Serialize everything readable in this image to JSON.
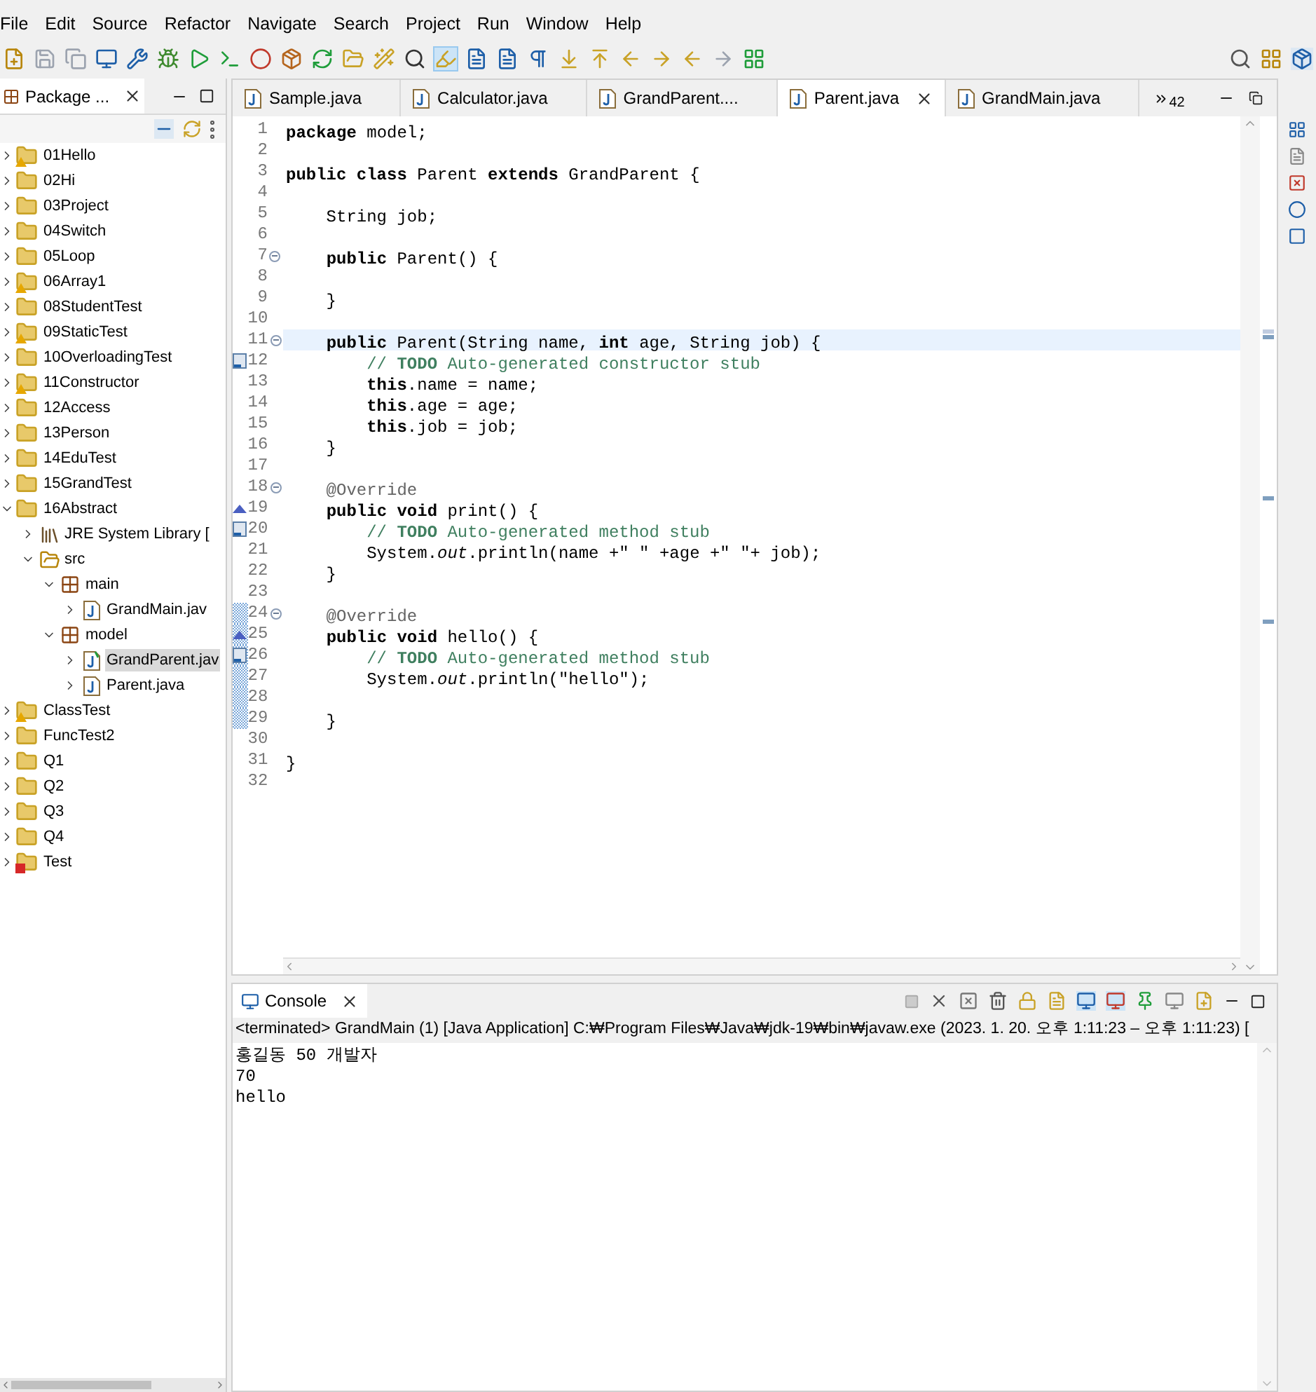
{
  "menu": [
    "File",
    "Edit",
    "Source",
    "Refactor",
    "Navigate",
    "Search",
    "Project",
    "Run",
    "Window",
    "Help"
  ],
  "package_explorer": {
    "title": "Package ...",
    "tree": [
      {
        "label": "01Hello",
        "kind": "project",
        "warning": true,
        "error": false,
        "expanded": false,
        "selected": false
      },
      {
        "label": "02Hi",
        "kind": "project",
        "warning": false,
        "error": false,
        "expanded": false,
        "selected": false
      },
      {
        "label": "03Project",
        "kind": "project",
        "warning": false,
        "error": false,
        "expanded": false,
        "selected": false
      },
      {
        "label": "04Switch",
        "kind": "project",
        "warning": false,
        "error": false,
        "expanded": false,
        "selected": false
      },
      {
        "label": "05Loop",
        "kind": "project",
        "warning": false,
        "error": false,
        "expanded": false,
        "selected": false
      },
      {
        "label": "06Array1",
        "kind": "project",
        "warning": true,
        "error": false,
        "expanded": false,
        "selected": false
      },
      {
        "label": "08StudentTest",
        "kind": "project",
        "warning": false,
        "error": false,
        "expanded": false,
        "selected": false
      },
      {
        "label": "09StaticTest",
        "kind": "project",
        "warning": true,
        "error": false,
        "expanded": false,
        "selected": false
      },
      {
        "label": "10OverloadingTest",
        "kind": "project",
        "warning": false,
        "error": false,
        "expanded": false,
        "selected": false
      },
      {
        "label": "11Constructor",
        "kind": "project",
        "warning": true,
        "error": false,
        "expanded": false,
        "selected": false
      },
      {
        "label": "12Access",
        "kind": "project",
        "warning": false,
        "error": false,
        "expanded": false,
        "selected": false
      },
      {
        "label": "13Person",
        "kind": "project",
        "warning": false,
        "error": false,
        "expanded": false,
        "selected": false
      },
      {
        "label": "14EduTest",
        "kind": "project",
        "warning": false,
        "error": false,
        "expanded": false,
        "selected": false
      },
      {
        "label": "15GrandTest",
        "kind": "project",
        "warning": false,
        "error": false,
        "expanded": false,
        "selected": false
      },
      {
        "label": "16Abstract",
        "kind": "project",
        "warning": false,
        "error": false,
        "expanded": true,
        "selected": false,
        "children": [
          {
            "label": "JRE System Library [",
            "kind": "library",
            "expanded": false,
            "selected": false
          },
          {
            "label": "src",
            "kind": "source-folder",
            "expanded": true,
            "selected": false,
            "children": [
              {
                "label": "main",
                "kind": "package",
                "expanded": true,
                "selected": false,
                "children": [
                  {
                    "label": "GrandMain.jav",
                    "kind": "java-file",
                    "expanded": false,
                    "selected": false
                  }
                ]
              },
              {
                "label": "model",
                "kind": "package",
                "expanded": true,
                "selected": false,
                "children": [
                  {
                    "label": "GrandParent.jav",
                    "kind": "abstract-file",
                    "expanded": false,
                    "selected": true
                  },
                  {
                    "label": "Parent.java",
                    "kind": "java-file",
                    "expanded": false,
                    "selected": false
                  }
                ]
              }
            ]
          }
        ]
      },
      {
        "label": "ClassTest",
        "kind": "project",
        "warning": true,
        "error": false,
        "expanded": false,
        "selected": false
      },
      {
        "label": "FuncTest2",
        "kind": "project",
        "warning": false,
        "error": false,
        "expanded": false,
        "selected": false
      },
      {
        "label": "Q1",
        "kind": "project",
        "warning": false,
        "error": false,
        "expanded": false,
        "selected": false
      },
      {
        "label": "Q2",
        "kind": "project",
        "warning": false,
        "error": false,
        "expanded": false,
        "selected": false
      },
      {
        "label": "Q3",
        "kind": "project",
        "warning": false,
        "error": false,
        "expanded": false,
        "selected": false
      },
      {
        "label": "Q4",
        "kind": "project",
        "warning": false,
        "error": false,
        "expanded": false,
        "selected": false
      },
      {
        "label": "Test",
        "kind": "project",
        "warning": false,
        "error": true,
        "expanded": false,
        "selected": false
      }
    ]
  },
  "editor": {
    "tabs": [
      {
        "label": "Sample.java",
        "selected": false
      },
      {
        "label": "Calculator.java",
        "selected": false
      },
      {
        "label": "GrandParent....",
        "selected": false
      },
      {
        "label": "Parent.java",
        "selected": true
      },
      {
        "label": "GrandMain.java",
        "selected": false
      }
    ],
    "hidden_tabs": "42",
    "lines": [
      {
        "n": "1",
        "fold": false,
        "current": false,
        "task": false,
        "override": false,
        "changed": false,
        "kind": "code",
        "text": "**package** model;"
      },
      {
        "n": "2",
        "fold": false,
        "current": false,
        "task": false,
        "override": false,
        "changed": false,
        "kind": "blank"
      },
      {
        "n": "3",
        "fold": false,
        "current": false,
        "task": false,
        "override": false,
        "changed": false,
        "kind": "code",
        "text": "**public class** Parent **extends** GrandParent {"
      },
      {
        "n": "4",
        "fold": false,
        "current": false,
        "task": false,
        "override": false,
        "changed": false,
        "kind": "blank"
      },
      {
        "n": "5",
        "fold": false,
        "current": false,
        "task": false,
        "override": false,
        "changed": false,
        "kind": "code",
        "text": "    String job;"
      },
      {
        "n": "6",
        "fold": false,
        "current": false,
        "task": false,
        "override": false,
        "changed": false,
        "kind": "blank"
      },
      {
        "n": "7",
        "fold": true,
        "current": false,
        "task": false,
        "override": false,
        "changed": false,
        "kind": "code",
        "text": "    **public** Parent() {"
      },
      {
        "n": "8",
        "fold": false,
        "current": false,
        "task": false,
        "override": false,
        "changed": false,
        "kind": "blank"
      },
      {
        "n": "9",
        "fold": false,
        "current": false,
        "task": false,
        "override": false,
        "changed": false,
        "kind": "code",
        "text": "    }"
      },
      {
        "n": "10",
        "fold": false,
        "current": false,
        "task": false,
        "override": false,
        "changed": false,
        "kind": "blank"
      },
      {
        "n": "11",
        "fold": true,
        "current": true,
        "task": false,
        "override": false,
        "changed": false,
        "kind": "code",
        "text": "    **public** Parent(String name, **int** age, String job) {"
      },
      {
        "n": "12",
        "fold": false,
        "current": false,
        "task": true,
        "override": false,
        "changed": false,
        "kind": "comment",
        "text": "        // **TODO** Auto-generated constructor stub"
      },
      {
        "n": "13",
        "fold": false,
        "current": false,
        "task": false,
        "override": false,
        "changed": false,
        "kind": "code",
        "text": "        **this**.name = name;"
      },
      {
        "n": "14",
        "fold": false,
        "current": false,
        "task": false,
        "override": false,
        "changed": false,
        "kind": "code",
        "text": "        **this**.age = age;"
      },
      {
        "n": "15",
        "fold": false,
        "current": false,
        "task": false,
        "override": false,
        "changed": false,
        "kind": "code",
        "text": "        **this**.job = job;"
      },
      {
        "n": "16",
        "fold": false,
        "current": false,
        "task": false,
        "override": false,
        "changed": false,
        "kind": "code",
        "text": "    }"
      },
      {
        "n": "17",
        "fold": false,
        "current": false,
        "task": false,
        "override": false,
        "changed": false,
        "kind": "blank"
      },
      {
        "n": "18",
        "fold": true,
        "current": false,
        "task": false,
        "override": false,
        "changed": false,
        "kind": "annotation",
        "text": "    @Override"
      },
      {
        "n": "19",
        "fold": false,
        "current": false,
        "task": false,
        "override": true,
        "changed": false,
        "kind": "code",
        "text": "    **public void** print() {"
      },
      {
        "n": "20",
        "fold": false,
        "current": false,
        "task": true,
        "override": false,
        "changed": false,
        "kind": "comment",
        "text": "        // **TODO** Auto-generated method stub"
      },
      {
        "n": "21",
        "fold": false,
        "current": false,
        "task": false,
        "override": false,
        "changed": false,
        "kind": "code",
        "text": "        System.*out*.println(name +\" \" +age +\" \"+ job);"
      },
      {
        "n": "22",
        "fold": false,
        "current": false,
        "task": false,
        "override": false,
        "changed": false,
        "kind": "code",
        "text": "    }"
      },
      {
        "n": "23",
        "fold": false,
        "current": false,
        "task": false,
        "override": false,
        "changed": false,
        "kind": "blank"
      },
      {
        "n": "24",
        "fold": true,
        "current": false,
        "task": false,
        "override": false,
        "changed": true,
        "kind": "annotation",
        "text": "    @Override"
      },
      {
        "n": "25",
        "fold": false,
        "current": false,
        "task": false,
        "override": true,
        "changed": true,
        "kind": "code",
        "text": "    **public void** hello() {"
      },
      {
        "n": "26",
        "fold": false,
        "current": false,
        "task": true,
        "override": false,
        "changed": true,
        "kind": "comment",
        "text": "        // **TODO** Auto-generated method stub"
      },
      {
        "n": "27",
        "fold": false,
        "current": false,
        "task": false,
        "override": false,
        "changed": true,
        "kind": "code",
        "text": "        System.*out*.println(\"hello\");"
      },
      {
        "n": "28",
        "fold": false,
        "current": false,
        "task": false,
        "override": false,
        "changed": true,
        "kind": "blank"
      },
      {
        "n": "29",
        "fold": false,
        "current": false,
        "task": false,
        "override": false,
        "changed": true,
        "kind": "code",
        "text": "    }"
      },
      {
        "n": "30",
        "fold": false,
        "current": false,
        "task": false,
        "override": false,
        "changed": false,
        "kind": "blank"
      },
      {
        "n": "31",
        "fold": false,
        "current": false,
        "task": false,
        "override": false,
        "changed": false,
        "kind": "code",
        "text": "}"
      },
      {
        "n": "32",
        "fold": false,
        "current": false,
        "task": false,
        "override": false,
        "changed": false,
        "kind": "blank"
      }
    ]
  },
  "console": {
    "title": "Console",
    "header": "<terminated> GrandMain (1) [Java Application] C:₩Program Files₩Java₩jdk-19₩bin₩javaw.exe  (2023. 1. 20. 오후 1:11:23 – 오후 1:11:23) [",
    "output": [
      "홍길동 50 개발자",
      "70",
      "hello"
    ]
  }
}
